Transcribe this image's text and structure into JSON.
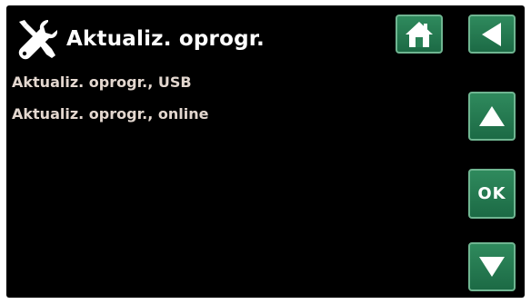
{
  "header": {
    "title": "Aktualiz. oprogr.",
    "icon": "tools-icon"
  },
  "menu": {
    "items": [
      {
        "label": "Aktualiz. oprogr., USB"
      },
      {
        "label": "Aktualiz. oprogr., online"
      }
    ]
  },
  "buttons": {
    "home_icon": "home-icon",
    "back_icon": "back-arrow-icon",
    "up_icon": "up-arrow-icon",
    "ok_label": "OK",
    "down_icon": "down-arrow-icon"
  },
  "colors": {
    "background": "#000000",
    "button_green": "#267a51",
    "button_border": "#6fb591",
    "menu_text": "#e3d7cf",
    "title_text": "#ffffff"
  }
}
